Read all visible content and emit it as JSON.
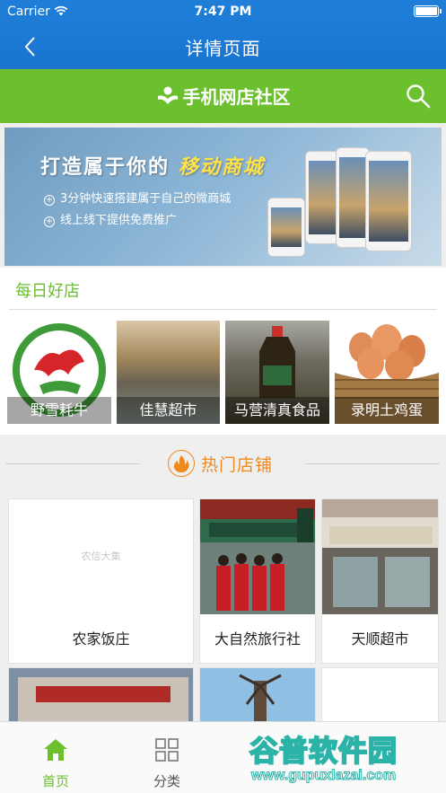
{
  "status_bar": {
    "carrier": "Carrier",
    "time": "7:47 PM"
  },
  "nav": {
    "title": "详情页面",
    "back_icon": "chevron-left-icon"
  },
  "header": {
    "brand": "手机网店社区",
    "search_icon": "search-icon"
  },
  "banner": {
    "title_plain": "打造属于你的",
    "title_highlight": "移动商城",
    "lines": [
      "3分钟快速搭建属于自己的微商城",
      "线上线下提供免费推广"
    ]
  },
  "daily_shops": {
    "title": "每日好店",
    "items": [
      {
        "label": "野雪耗牛"
      },
      {
        "label": "佳慧超市"
      },
      {
        "label": "马营清真食品"
      },
      {
        "label": "录明土鸡蛋"
      }
    ]
  },
  "hot_shops": {
    "title": "热门店铺",
    "placeholder_text": "农信大集",
    "items": [
      {
        "name": "农家饭庄"
      },
      {
        "name": "大自然旅行社"
      },
      {
        "name": "天顺超市"
      }
    ]
  },
  "tabbar": {
    "tabs": [
      {
        "label": "首页",
        "icon": "home-icon",
        "active": true
      },
      {
        "label": "分类",
        "icon": "grid-icon",
        "active": false
      }
    ]
  },
  "watermark": {
    "text": "谷普软件园",
    "url": "www.gupuxlazai.com"
  },
  "colors": {
    "nav_blue": "#1a74d0",
    "brand_green": "#6cbf2d",
    "hot_orange": "#f08a1e"
  }
}
